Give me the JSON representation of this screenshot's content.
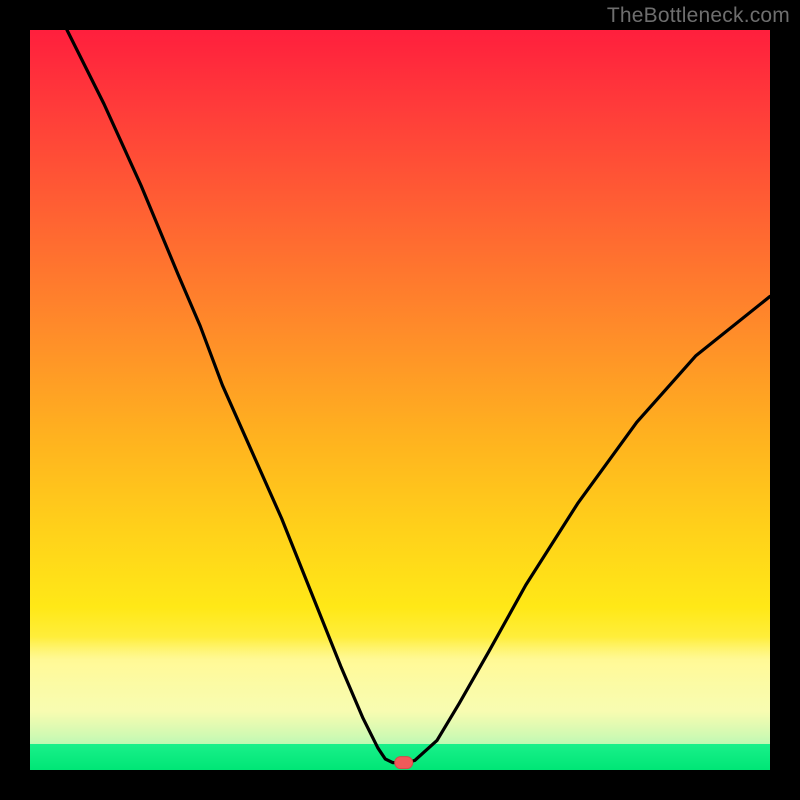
{
  "watermark": "TheBottleneck.com",
  "colors": {
    "gradient_top": "#ff1f3d",
    "gradient_mid": "#ffe817",
    "gradient_bottom": "#2fe38a",
    "curve": "#000000",
    "marker": "#f05a5a",
    "frame": "#000000"
  },
  "chart_data": {
    "type": "line",
    "title": "",
    "xlabel": "",
    "ylabel": "",
    "xlim": [
      0,
      100
    ],
    "ylim": [
      0,
      100
    ],
    "series": [
      {
        "name": "bottleneck-curve",
        "x": [
          5,
          10,
          15,
          20,
          23,
          26,
          30,
          34,
          38,
          42,
          45,
          47,
          48,
          49,
          50,
          51,
          52,
          55,
          58,
          62,
          67,
          74,
          82,
          90,
          100
        ],
        "y": [
          100,
          90,
          79,
          67,
          60,
          52,
          43,
          34,
          24,
          14,
          7,
          3,
          1.5,
          1,
          1,
          1,
          1.3,
          4,
          9,
          16,
          25,
          36,
          47,
          56,
          64
        ]
      }
    ],
    "marker": {
      "x": 50.5,
      "y": 1,
      "shape": "pill"
    },
    "background_encoding": "vertical color gradient red→yellow→green representing bottleneck severity (red high, green low)"
  }
}
